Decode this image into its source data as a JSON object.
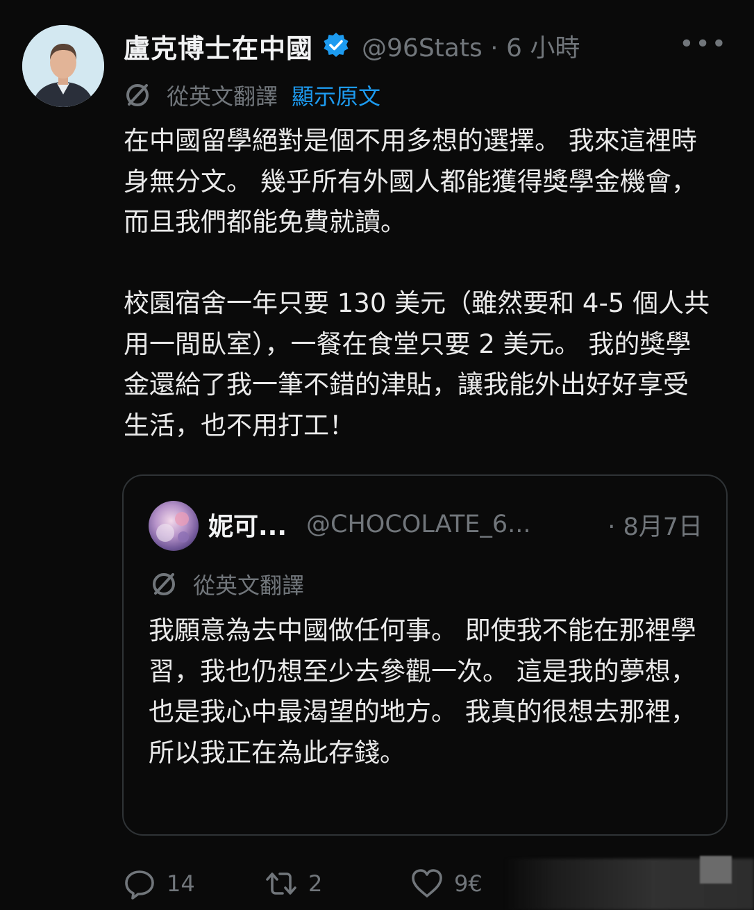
{
  "tweet": {
    "author_name": "盧克博士在中國",
    "handle_time": "@96Stats · 6 小時",
    "more_icon": "more-horizontal-icon",
    "translate_label": "從英文翻譯",
    "show_original_label": "顯示原文",
    "body_paragraphs": [
      "在中國留學絕對是個不用多想的選擇。 我來這裡時身無分文。 幾乎所有外國人都能獲得獎學金機會，而且我們都能免費就讀。",
      "校園宿舍一年只要 130 美元（雖然要和 4-5 個人共用一間臥室），一餐在食堂只要 2 美元。 我的獎學金還給了我一筆不錯的津貼，讓我能外出好好享受生活，也不用打工！"
    ]
  },
  "quote": {
    "author_name": "妮可...",
    "handle": "@CHOCOLATE_6...",
    "date": "· 8月7日",
    "translate_label": "從英文翻譯",
    "body": "我願意為去中國做任何事。 即使我不能在那裡學習，我也仍想至少去參觀一次。 這是我的夢想，也是我心中最渴望的地方。 我真的很想去那裡，所以我正在為此存錢。"
  },
  "actions": {
    "reply_count": "14",
    "retweet_count": "2",
    "like_count": "9€"
  },
  "colors": {
    "background": "#0a0a0a",
    "text": "#e7e9ea",
    "muted": "#71767b",
    "accent": "#1d9bf0",
    "border": "#2f3336"
  }
}
